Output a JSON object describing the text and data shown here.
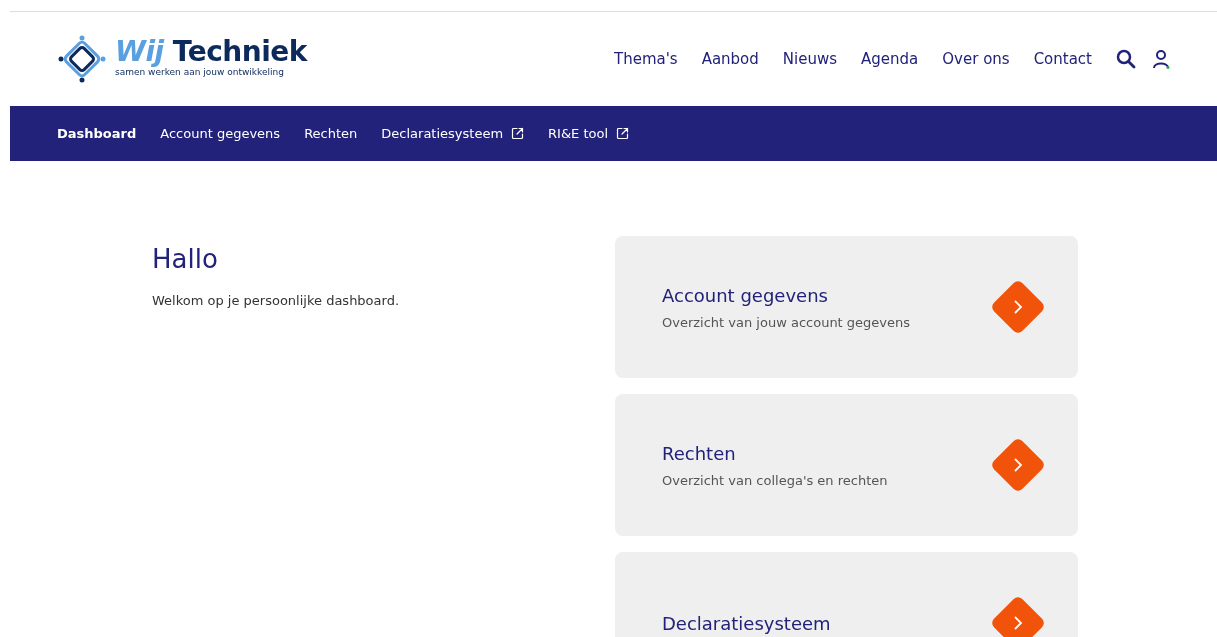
{
  "logo": {
    "name_light": "Wij",
    "name_bold": "Techniek",
    "tagline": "samen werken aan jouw ontwikkeling"
  },
  "main_nav": [
    {
      "label": "Thema's"
    },
    {
      "label": "Aanbod"
    },
    {
      "label": "Nieuws"
    },
    {
      "label": "Agenda"
    },
    {
      "label": "Over ons"
    },
    {
      "label": "Contact"
    }
  ],
  "sub_nav": [
    {
      "label": "Dashboard",
      "selected": true,
      "external": false
    },
    {
      "label": "Account gegevens",
      "selected": false,
      "external": false
    },
    {
      "label": "Rechten",
      "selected": false,
      "external": false
    },
    {
      "label": "Declaratiesysteem",
      "selected": false,
      "external": true
    },
    {
      "label": "RI&E tool",
      "selected": false,
      "external": true
    }
  ],
  "intro": {
    "heading": "Hallo",
    "text": "Welkom op je persoonlijke dashboard."
  },
  "cards": [
    {
      "title": "Account gegevens",
      "description": "Overzicht van jouw account gegevens"
    },
    {
      "title": "Rechten",
      "description": "Overzicht van collega's en rechten"
    },
    {
      "title": "Declaratiesysteem"
    }
  ]
}
